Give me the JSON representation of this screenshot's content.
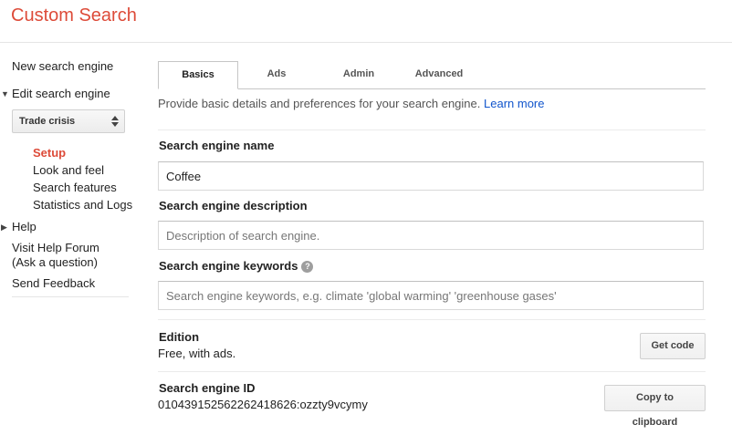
{
  "app": {
    "title": "Custom Search",
    "accent_color": "#dd4b39",
    "link_color": "#1155cc"
  },
  "sidebar": {
    "new_engine": "New search engine",
    "edit_engine": "Edit search engine",
    "selected_engine": "Trade crisis",
    "sub_items": [
      "Setup",
      "Look and feel",
      "Search features",
      "Statistics and Logs"
    ],
    "help": "Help",
    "help_forum_line1": "Visit Help Forum",
    "help_forum_line2": "(Ask a question)",
    "send_feedback": "Send Feedback"
  },
  "tabs": [
    "Basics",
    "Ads",
    "Admin",
    "Advanced"
  ],
  "intro": {
    "text": "Provide basic details and preferences for your search engine.",
    "learn_more": "Learn more"
  },
  "fields": {
    "name_label": "Search engine name",
    "name_value": "Coffee",
    "description_label": "Search engine description",
    "description_placeholder": "Description of search engine.",
    "keywords_label": "Search engine keywords",
    "keywords_placeholder": "Search engine keywords, e.g. climate 'global warming' 'greenhouse gases'"
  },
  "edition": {
    "label": "Edition",
    "value": "Free, with ads.",
    "button": "Get code"
  },
  "engine_id": {
    "label": "Search engine ID",
    "value": "010439152562262418626:ozzty9vcymy",
    "button": "Copy to clipboard"
  }
}
